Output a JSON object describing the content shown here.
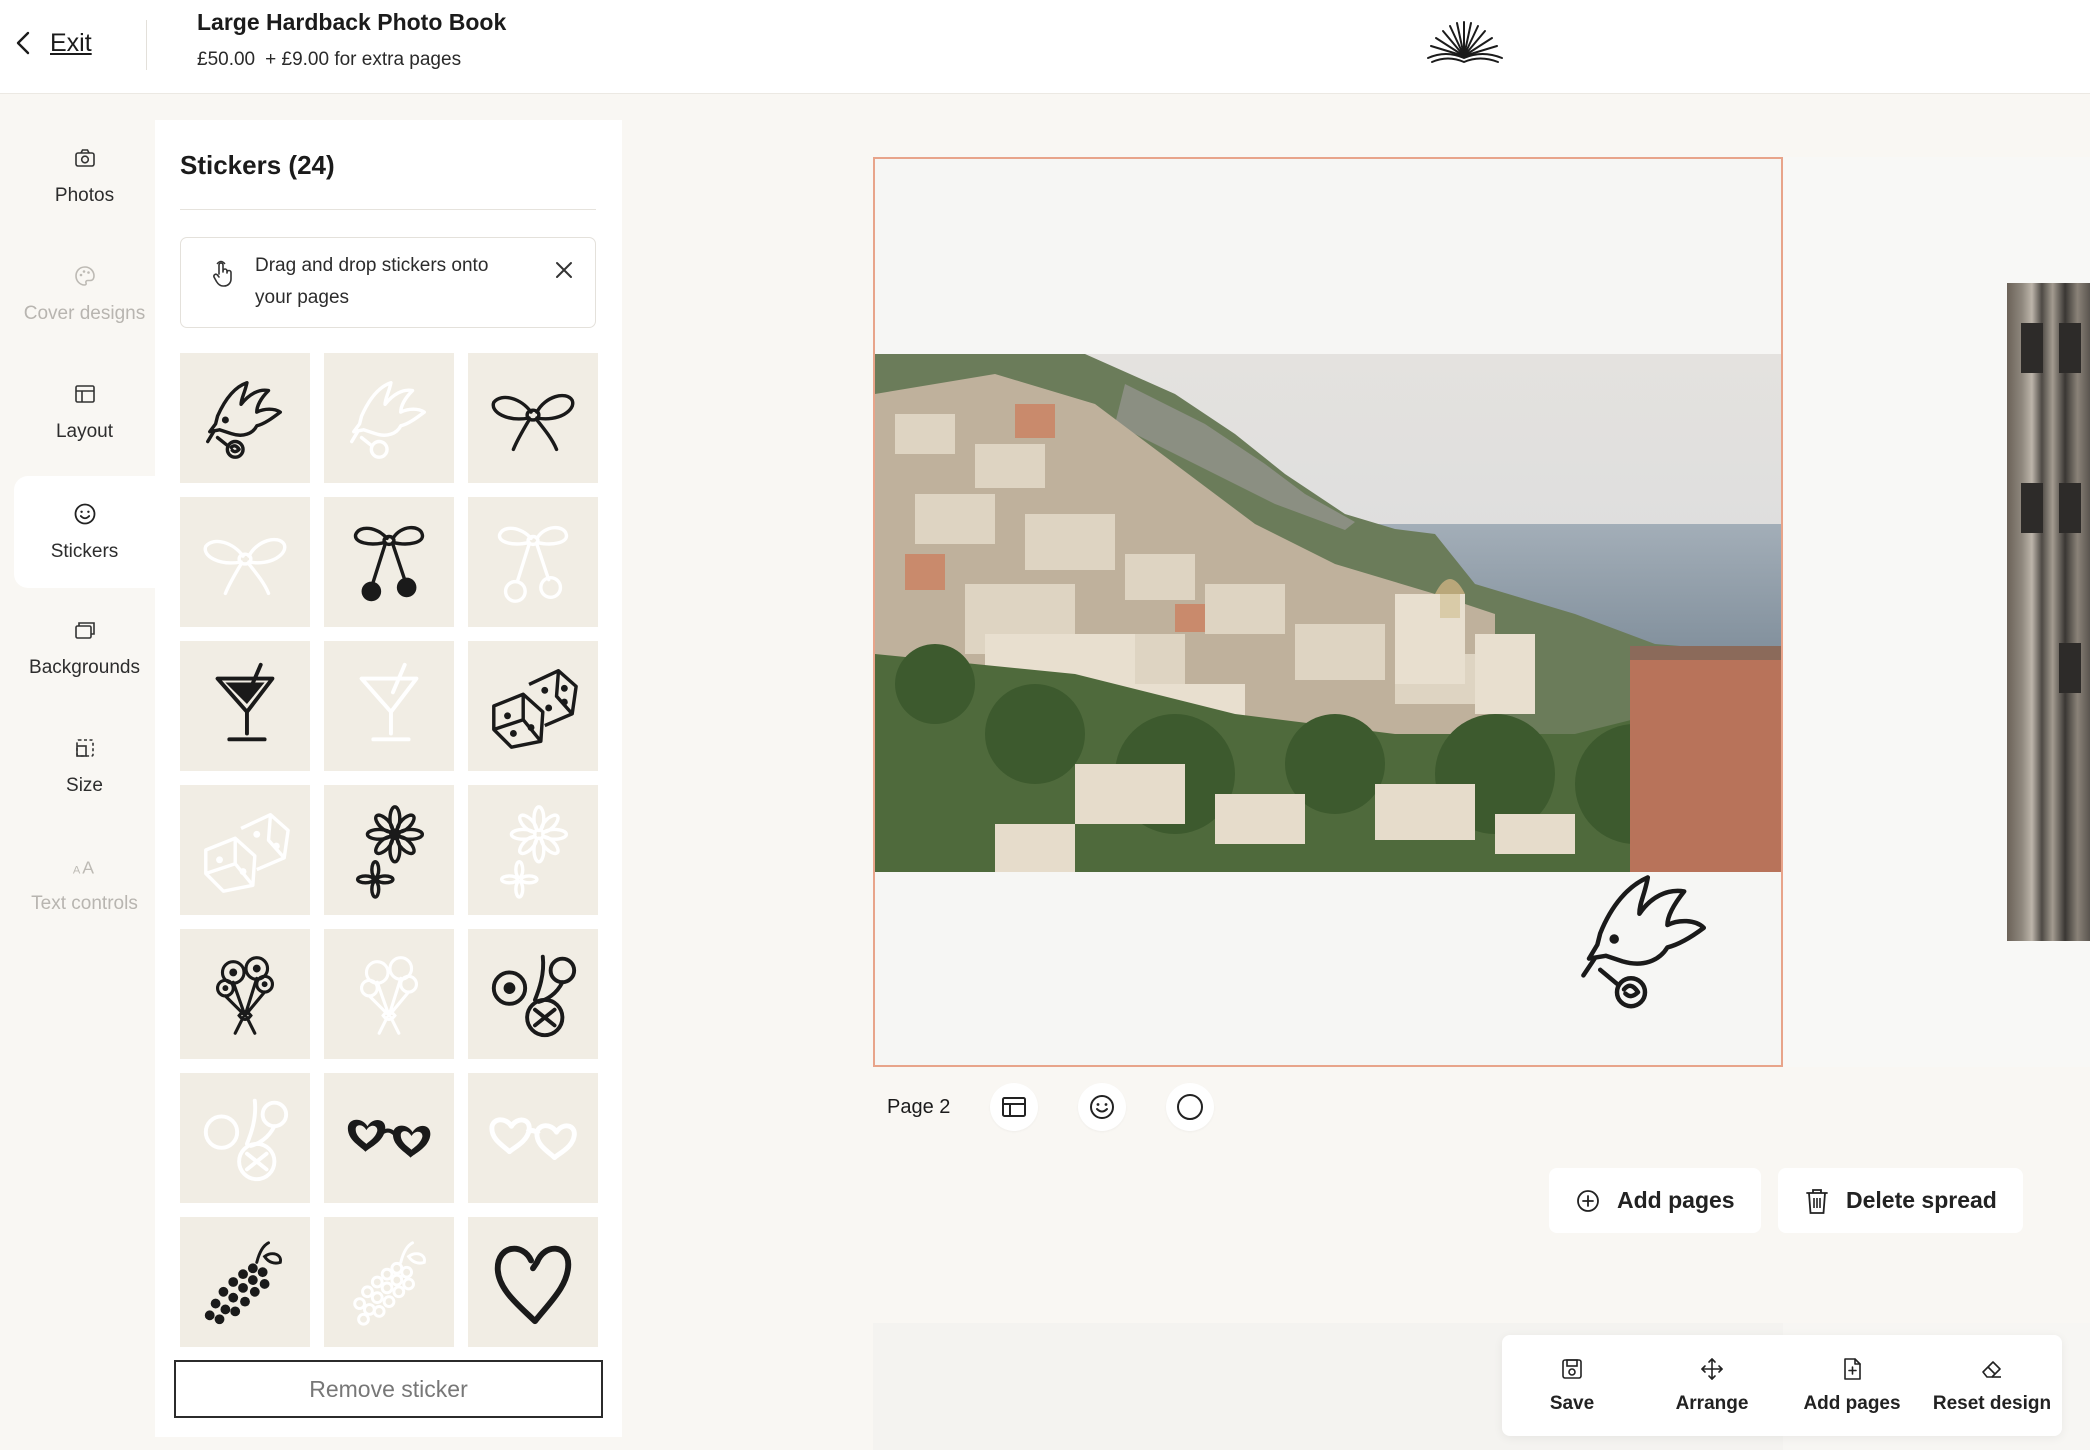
{
  "header": {
    "exit_label": "Exit",
    "product_title": "Large Hardback Photo Book",
    "price": "£50.00",
    "extra_price": "+ £9.00 for extra pages"
  },
  "nav": {
    "items": [
      {
        "label": "Photos",
        "icon": "camera-icon",
        "state": "enabled"
      },
      {
        "label": "Cover designs",
        "icon": "palette-icon",
        "state": "disabled"
      },
      {
        "label": "Layout",
        "icon": "layout-icon",
        "state": "enabled"
      },
      {
        "label": "Stickers",
        "icon": "smiley-icon",
        "state": "active"
      },
      {
        "label": "Backgrounds",
        "icon": "backgrounds-icon",
        "state": "enabled"
      },
      {
        "label": "Size",
        "icon": "size-icon",
        "state": "enabled"
      },
      {
        "label": "Text controls",
        "icon": "text-size-icon",
        "state": "disabled"
      }
    ]
  },
  "stickers_panel": {
    "title": "Stickers (24)",
    "hint_text": "Drag and drop stickers onto your pages",
    "remove_label": "Remove sticker",
    "stickers": [
      {
        "name": "dove-with-rose",
        "style": "black"
      },
      {
        "name": "dove-with-rose",
        "style": "white"
      },
      {
        "name": "bow",
        "style": "black"
      },
      {
        "name": "bow",
        "style": "white"
      },
      {
        "name": "bow-cherries",
        "style": "black"
      },
      {
        "name": "bow-cherries",
        "style": "white"
      },
      {
        "name": "martini",
        "style": "black"
      },
      {
        "name": "martini",
        "style": "white"
      },
      {
        "name": "dice",
        "style": "black"
      },
      {
        "name": "dice",
        "style": "white"
      },
      {
        "name": "daisies",
        "style": "black"
      },
      {
        "name": "daisies",
        "style": "white"
      },
      {
        "name": "flower-bouquet",
        "style": "black"
      },
      {
        "name": "flower-bouquet",
        "style": "white"
      },
      {
        "name": "cherries-citrus",
        "style": "black"
      },
      {
        "name": "cherries-citrus",
        "style": "white"
      },
      {
        "name": "heart-glasses",
        "style": "black"
      },
      {
        "name": "heart-glasses",
        "style": "white"
      },
      {
        "name": "grapes",
        "style": "black"
      },
      {
        "name": "grapes",
        "style": "white"
      },
      {
        "name": "heart",
        "style": "black"
      }
    ]
  },
  "canvas": {
    "page_label": "Page 2",
    "add_pages_label": "Add pages",
    "delete_spread_label": "Delete spread",
    "accent_border": "#e8a48a"
  },
  "toolbar": {
    "items": [
      {
        "label": "Save",
        "icon": "save-icon"
      },
      {
        "label": "Arrange",
        "icon": "arrange-icon"
      },
      {
        "label": "Add pages",
        "icon": "add-page-icon"
      },
      {
        "label": "Reset design",
        "icon": "eraser-icon"
      }
    ]
  }
}
